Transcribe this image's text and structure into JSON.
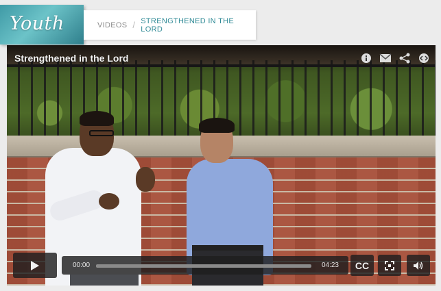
{
  "brand": {
    "logo_text": "Youth"
  },
  "breadcrumb": {
    "parent": "VIDEOS",
    "separator": "/",
    "current": "STRENGTHENED IN THE LORD"
  },
  "video": {
    "title": "Strengthened in the Lord",
    "top_icons": [
      "info-icon",
      "email-icon",
      "share-icon",
      "embed-icon"
    ],
    "controls": {
      "current_time": "00:00",
      "total_time": "04:23",
      "progress_fraction": 0,
      "cc_label": "CC"
    }
  },
  "colors": {
    "accent": "#2f8a96",
    "logo_bg": "#3f9aa6",
    "control_bg": "#1e1e1e"
  }
}
